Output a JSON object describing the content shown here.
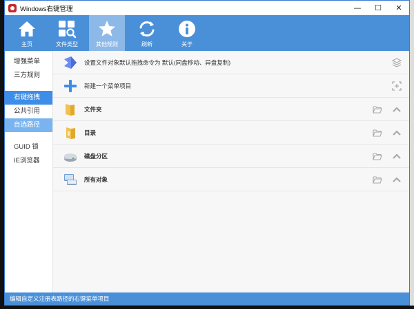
{
  "window": {
    "title": "Windows右键管理",
    "controls": {
      "minimize": "—",
      "maximize": "☐",
      "close": "✕"
    }
  },
  "toolbar": {
    "items": [
      {
        "label": "主页",
        "icon": "home-icon"
      },
      {
        "label": "文件类型",
        "icon": "file-search-icon"
      },
      {
        "label": "其他规则",
        "icon": "star-icon",
        "active": true
      },
      {
        "label": "刷新",
        "icon": "refresh-icon"
      },
      {
        "label": "关于",
        "icon": "info-icon"
      }
    ]
  },
  "sidebar": {
    "groups": [
      [
        "增强菜单",
        "三方规则"
      ],
      [
        "右键拖拽",
        "公共引用",
        "自选路径"
      ],
      [
        "GUID 锁",
        "IE浏览器"
      ]
    ],
    "selected": "右键拖拽",
    "hover": "自选路径"
  },
  "rows": [
    {
      "text": "设置文件对象默认拖拽命令为 默认(同盘移动、异盘复制)",
      "icon": "drag-command-icon",
      "right_icons": [
        "layers-icon"
      ]
    },
    {
      "text": "新建一个菜单项目",
      "icon": "add-icon",
      "right_icons": [
        "add-box-icon"
      ]
    },
    {
      "text": "文件夹",
      "icon": "folder-icon",
      "right_icons": [
        "open-folder-icon",
        "chevron-up-icon"
      ]
    },
    {
      "text": "目录",
      "icon": "directory-icon",
      "right_icons": [
        "open-folder-icon",
        "chevron-up-icon"
      ]
    },
    {
      "text": "磁盘分区",
      "icon": "disk-icon",
      "right_icons": [
        "open-folder-icon",
        "chevron-up-icon"
      ]
    },
    {
      "text": "所有对象",
      "icon": "all-objects-icon",
      "right_icons": [
        "open-folder-icon",
        "chevron-up-icon"
      ]
    }
  ],
  "status": {
    "text": "编辑自定义注册表路径的右键菜单项目"
  },
  "colors": {
    "accent": "#4a90d9",
    "selected": "#3d8ee8",
    "hover": "#7ab4f0"
  }
}
